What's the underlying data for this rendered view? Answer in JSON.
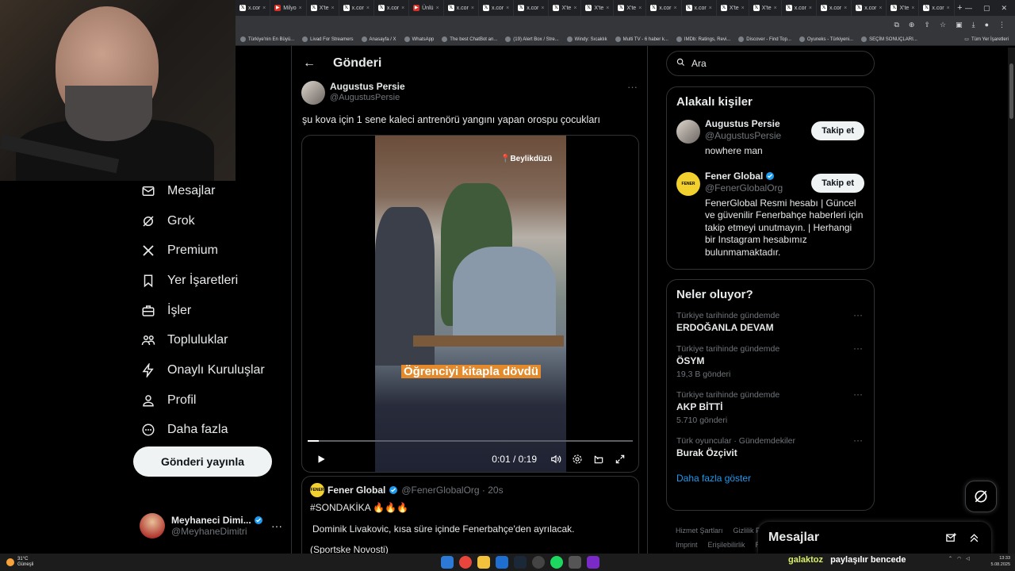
{
  "browser": {
    "tabs": [
      {
        "label": "x.cor",
        "icon": "X"
      },
      {
        "label": "Milyo",
        "icon": "red"
      },
      {
        "label": "X'te",
        "icon": "X"
      },
      {
        "label": "x.cor",
        "icon": "X"
      },
      {
        "label": "x.cor",
        "icon": "X"
      },
      {
        "label": "Ünlü",
        "icon": "red"
      },
      {
        "label": "x.cor",
        "icon": "X"
      },
      {
        "label": "x.cor",
        "icon": "X"
      },
      {
        "label": "x.cor",
        "icon": "X"
      },
      {
        "label": "X'te",
        "icon": "X"
      },
      {
        "label": "X'te",
        "icon": "X"
      },
      {
        "label": "X'te",
        "icon": "X"
      },
      {
        "label": "x.cor",
        "icon": "X"
      },
      {
        "label": "x.cor",
        "icon": "X"
      },
      {
        "label": "X'te",
        "icon": "X"
      },
      {
        "label": "X'te",
        "icon": "X"
      },
      {
        "label": "x.cor",
        "icon": "X"
      },
      {
        "label": "x.cor",
        "icon": "X"
      },
      {
        "label": "x.cor",
        "icon": "X"
      },
      {
        "label": "X'te",
        "icon": "X"
      },
      {
        "label": "x.cor",
        "icon": "X"
      }
    ],
    "bookmarks": [
      "Türkiye'nin En Büyü...",
      "Livad For Streamers",
      "Anasayfa / X",
      "WhatsApp",
      "The best ChatBot an...",
      "(19) Alert Box / Stre...",
      "Windy: Sıcaklık",
      "Multi TV - 6 haber k...",
      "IMDb: Ratings, Revi...",
      "Discover - Find Top...",
      "Oyuneks - Türkiyeni...",
      "SEÇİM SONUÇLARI..."
    ],
    "bookmarks_folder": "Tüm Yer İşaretleri"
  },
  "sidebar": {
    "items": [
      {
        "label": "Mesajlar",
        "icon": "envelope-icon"
      },
      {
        "label": "Grok",
        "icon": "grok-icon"
      },
      {
        "label": "Premium",
        "icon": "x-logo-icon"
      },
      {
        "label": "Yer İşaretleri",
        "icon": "bookmark-icon"
      },
      {
        "label": "İşler",
        "icon": "briefcase-icon"
      },
      {
        "label": "Topluluklar",
        "icon": "people-icon"
      },
      {
        "label": "Onaylı Kuruluşlar",
        "icon": "lightning-icon"
      },
      {
        "label": "Profil",
        "icon": "person-icon"
      },
      {
        "label": "Daha fazla",
        "icon": "more-circle-icon"
      }
    ],
    "post_button": "Gönderi yayınla",
    "account": {
      "name": "Meyhaneci Dimi...",
      "handle": "@MeyhaneDimitri",
      "more": "···"
    }
  },
  "main": {
    "header_title": "Gönderi",
    "tweet": {
      "author": "Augustus Persie",
      "handle": "@AugustusPersie",
      "more": "···",
      "text": "şu kova için 1 sene kaleci antrenörü yangını yapan orospu çocukları",
      "video": {
        "location": "📍Beylikdüzü",
        "caption": "Öğrenciyi kitapla dövdü",
        "time": "0:01 / 0:19",
        "progress_fraction": 0.035
      }
    },
    "quote": {
      "author": "Fener Global",
      "avatar_text": "FENER GLOBAL",
      "handle": "@FenerGlobalOrg · 20s",
      "line1": "#SONDAKİKA 🔥🔥🔥",
      "line2": "Dominik Livakovic, kısa süre içinde Fenerbahçe'den ayrılacak.",
      "line3": "(Sportske Novosti)"
    }
  },
  "right": {
    "search_placeholder": "Ara",
    "relevant_title": "Alakalı kişiler",
    "people": [
      {
        "name": "Augustus Persie",
        "handle": "@AugustusPersie",
        "bio": "nowhere man",
        "follow": "Takip et",
        "verified": false
      },
      {
        "name": "Fener Global",
        "handle": "@FenerGlobalOrg",
        "bio": "FenerGlobal Resmi hesabı | Güncel ve güvenilir Fenerbahçe haberleri için takip etmeyi unutmayın. | Herhangi bir Instagram hesabımız bulunmamaktadır.",
        "follow": "Takip et",
        "verified": true
      }
    ],
    "trends_title": "Neler oluyor?",
    "trends": [
      {
        "meta": "Türkiye tarihinde gündemde",
        "name": "ERDOĞANLA DEVAM",
        "count": ""
      },
      {
        "meta": "Türkiye tarihinde gündemde",
        "name": "ÖSYM",
        "count": "19,3 B gönderi"
      },
      {
        "meta": "Türkiye tarihinde gündemde",
        "name": "AKP BİTTİ",
        "count": "5.710 gönderi"
      },
      {
        "meta": "Türk oyuncular · Gündemdekiler",
        "name": "Burak Özçivit",
        "count": ""
      }
    ],
    "show_more": "Daha fazla göster",
    "footer": [
      "Hizmet Şartları",
      "Gizlilik P",
      "Imprint",
      "Erişilebilirlik",
      "R"
    ]
  },
  "messages_drawer": {
    "title": "Mesajlar"
  },
  "taskbar": {
    "weather_temp": "31°C",
    "weather_text": "Güneşli",
    "overlay_user": "galaktoz",
    "overlay_msg": "paylaşılır bencede",
    "time": "13:33",
    "date": "5.08.2025"
  },
  "colors": {
    "accent": "#1d9bf0",
    "background": "#000000",
    "caption_bg": "#e58a2b"
  }
}
